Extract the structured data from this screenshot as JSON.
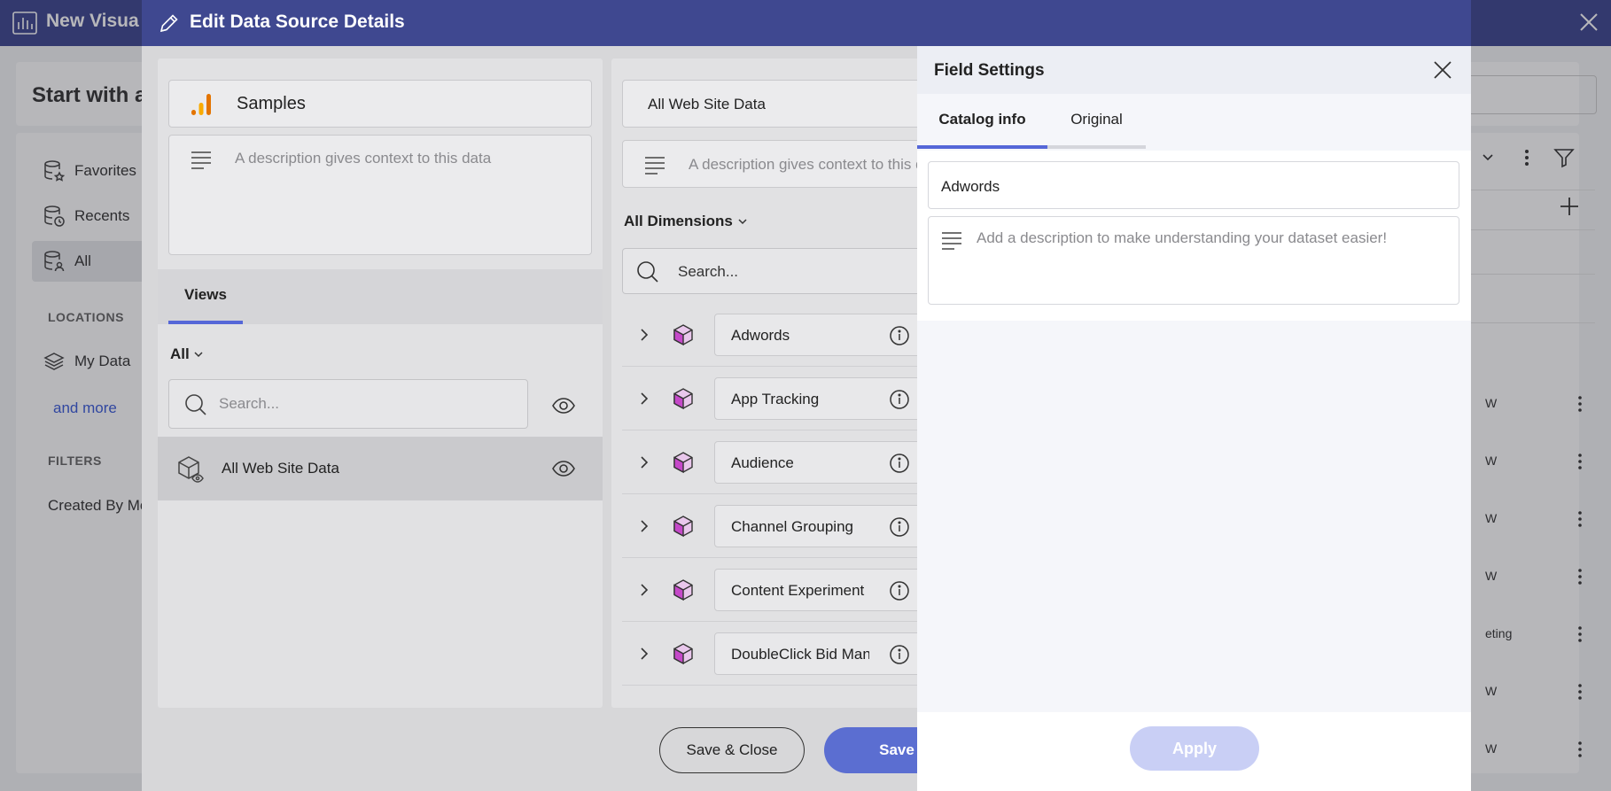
{
  "app": {
    "title": "New Visua",
    "start_title": "Start with a"
  },
  "sidebar": {
    "items": [
      {
        "label": "Favorites"
      },
      {
        "label": "Recents"
      },
      {
        "label": "All"
      }
    ],
    "locations_label": "LOCATIONS",
    "locations_item": "My Data",
    "and_more": "and more",
    "filters_label": "FILTERS",
    "filters_item": "Created By Me"
  },
  "background_list": {
    "rows": [
      "W",
      "W",
      "W",
      "W",
      "eting",
      "W",
      "W"
    ]
  },
  "modal": {
    "title": "Edit Data Source Details",
    "source": {
      "name": "Samples",
      "description_placeholder": "A description gives context to this data"
    },
    "views": {
      "tab_label": "Views",
      "filter_label": "All",
      "search_placeholder": "Search...",
      "items": [
        {
          "label": "All Web Site Data"
        }
      ]
    },
    "dataset": {
      "name": "All Web Site Data",
      "description_placeholder": "A description gives context to this data",
      "dimensions_filter": "All Dimensions",
      "search_placeholder": "Search...",
      "dimensions": [
        {
          "label": "Adwords"
        },
        {
          "label": "App Tracking"
        },
        {
          "label": "Audience"
        },
        {
          "label": "Channel Grouping"
        },
        {
          "label": "Content Experiment"
        },
        {
          "label": "DoubleClick Bid Man"
        }
      ]
    },
    "footer": {
      "save_close_label": "Save & Close",
      "save_label": "Save"
    }
  },
  "field_settings": {
    "title": "Field Settings",
    "tabs": [
      {
        "label": "Catalog info"
      },
      {
        "label": "Original"
      }
    ],
    "name_value": "Adwords",
    "description_placeholder": "Add a description to make understanding your dataset easier!",
    "apply_label": "Apply"
  },
  "colors": {
    "header_bg": "#3f4890",
    "accent": "#5567d8",
    "primary_button": "#5b6ed1",
    "apply_disabled": "#c9cff5",
    "link": "#3a5bd9",
    "cube": "#c548c9"
  }
}
